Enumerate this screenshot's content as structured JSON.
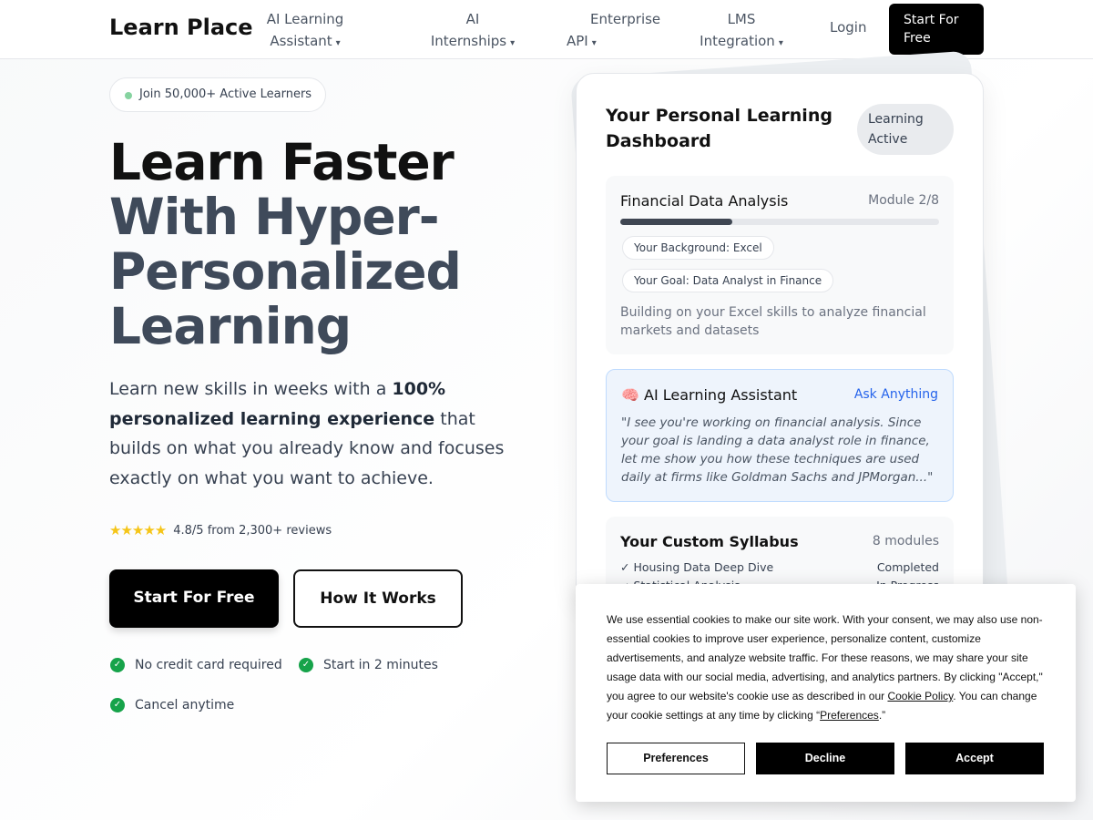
{
  "nav": {
    "logo": "Learn Place",
    "items": [
      {
        "line1": "AI Learning",
        "line2": "Assistant"
      },
      {
        "line1": "AI",
        "line2": "Internships"
      },
      {
        "line1": "Enterprise",
        "line2": "API"
      },
      {
        "line1": "LMS",
        "line2": "Integration"
      }
    ],
    "caret": "▾",
    "login": "Login",
    "cta": "Start For Free"
  },
  "hero": {
    "badge": "Join 50,000+ Active Learners",
    "headline_line1": "Learn Faster",
    "headline_line2": "With Hyper-",
    "headline_line3": "Personalized",
    "headline_line4": "Learning",
    "sub_part1": "Learn new skills in weeks with a ",
    "sub_bold": "100% personalized learning experience",
    "sub_part2": " that builds on what you already know and focuses exactly on what you want to achieve.",
    "stars": "★★★★★",
    "rating": "4.8/5 from 2,300+ reviews",
    "primary_button": "Start For Free",
    "secondary_button": "How It Works",
    "check_glyph": "✓",
    "perks": [
      "No credit card required",
      "Start in 2 minutes",
      "Cancel anytime"
    ]
  },
  "dashboard": {
    "title": "Your Personal Learning Dashboard",
    "status": "Learning Active",
    "module": {
      "name": "Financial Data Analysis",
      "count": "Module 2/8",
      "progress": 0.35,
      "tag1": "Your Background: Excel",
      "tag2": "Your Goal: Data Analyst in Finance",
      "description": "Building on your Excel skills to analyze financial markets and datasets"
    },
    "ai": {
      "icon": "🧠",
      "title": "AI Learning Assistant",
      "ask": "Ask Anything",
      "quote": "\"I see you're working on financial analysis. Since your goal is landing a data analyst role in finance, let me show you how these techniques are used daily at firms like Goldman Sachs and JPMorgan...\""
    },
    "syllabus": {
      "title": "Your Custom Syllabus",
      "count": "8 modules",
      "rows": [
        {
          "name": "✓ Housing Data Deep Dive",
          "status": "Completed"
        },
        {
          "name": "→ Statistical Analysis",
          "status": "In Progress"
        }
      ]
    }
  },
  "cookie": {
    "text_part1": "We use essential cookies to make our site work. With your consent, we may also use non-essential cookies to improve user experience, personalize content, customize advertisements, and analyze website traffic. For these reasons, we may share your site usage data with our social media, advertising, and analytics partners. By clicking \"Accept,\" you agree to our website's cookie use as described in our ",
    "policy_link": "Cookie Policy",
    "text_part2": ". You can change your cookie settings at any time by clicking “",
    "pref_link": "Preferences",
    "text_part3": ".”",
    "preferences": "Preferences",
    "decline": "Decline",
    "accept": "Accept"
  }
}
